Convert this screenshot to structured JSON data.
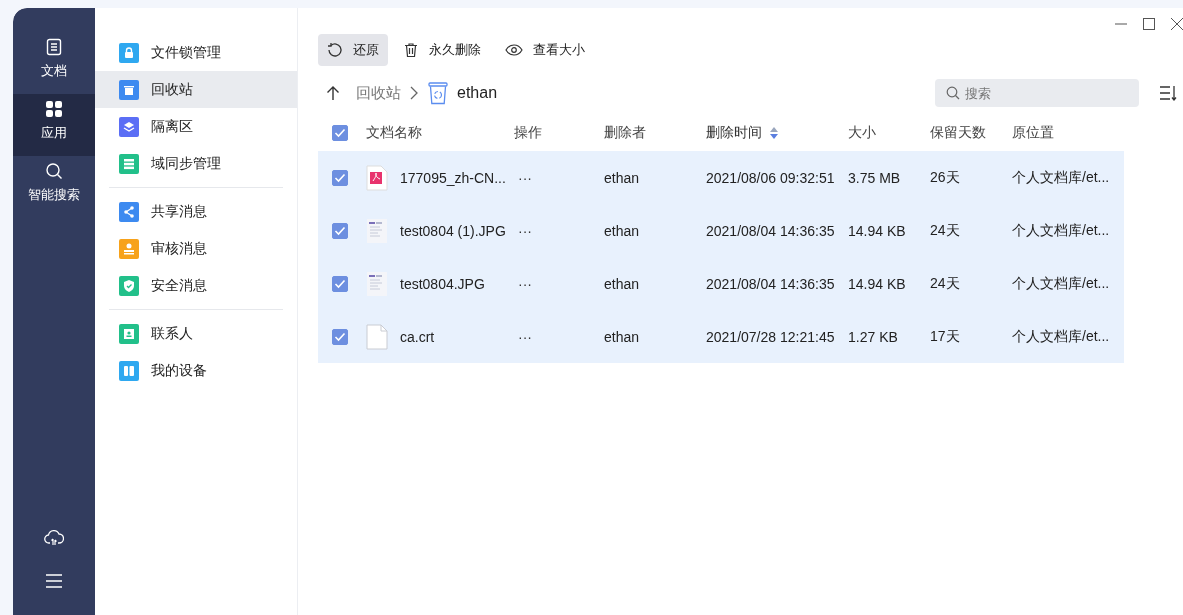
{
  "nav_rail": {
    "items": [
      {
        "label": "文档",
        "selected": false
      },
      {
        "label": "应用",
        "selected": true
      },
      {
        "label": "智能搜索",
        "selected": false
      }
    ]
  },
  "sidebar": {
    "groups": [
      [
        {
          "label": "文件锁管理",
          "color": "#2fa8f0",
          "selected": false
        },
        {
          "label": "回收站",
          "color": "#3d8af0",
          "selected": true
        },
        {
          "label": "隔离区",
          "color": "#5b6ef5",
          "selected": false
        },
        {
          "label": "域同步管理",
          "color": "#22c08a",
          "selected": false
        }
      ],
      [
        {
          "label": "共享消息",
          "color": "#3d8af0",
          "selected": false
        },
        {
          "label": "审核消息",
          "color": "#f7a21b",
          "selected": false
        },
        {
          "label": "安全消息",
          "color": "#22c08a",
          "selected": false
        }
      ],
      [
        {
          "label": "联系人",
          "color": "#22c08a",
          "selected": false
        },
        {
          "label": "我的设备",
          "color": "#2fa8f0",
          "selected": false
        }
      ]
    ]
  },
  "toolbar": [
    {
      "label": "还原",
      "selected": true
    },
    {
      "label": "永久删除",
      "selected": false
    },
    {
      "label": "查看大小",
      "selected": false
    }
  ],
  "breadcrumb": {
    "parent": "回收站",
    "current": "ethan"
  },
  "search": {
    "placeholder": "搜索"
  },
  "table": {
    "all_checked": true,
    "columns": [
      {
        "label": "文档名称",
        "sorted": false
      },
      {
        "label": "操作",
        "sorted": false
      },
      {
        "label": "删除者",
        "sorted": false
      },
      {
        "label": "删除时间",
        "sorted": true
      },
      {
        "label": "大小",
        "sorted": false
      },
      {
        "label": "保留天数",
        "sorted": false
      },
      {
        "label": "原位置",
        "sorted": false
      }
    ],
    "rows": [
      {
        "checked": true,
        "kind": "pdf",
        "name": "177095_zh-CN...",
        "actions": "···",
        "deleter": "ethan",
        "time": "2021/08/06 09:32:51",
        "size": "3.75 MB",
        "days": "26天",
        "location": "个人文档库/et..."
      },
      {
        "checked": true,
        "kind": "image",
        "name": "test0804 (1).JPG",
        "actions": "···",
        "deleter": "ethan",
        "time": "2021/08/04 14:36:35",
        "size": "14.94 KB",
        "days": "24天",
        "location": "个人文档库/et..."
      },
      {
        "checked": true,
        "kind": "image",
        "name": "test0804.JPG",
        "actions": "···",
        "deleter": "ethan",
        "time": "2021/08/04 14:36:35",
        "size": "14.94 KB",
        "days": "24天",
        "location": "个人文档库/et..."
      },
      {
        "checked": true,
        "kind": "file",
        "name": "ca.crt",
        "actions": "···",
        "deleter": "ethan",
        "time": "2021/07/28 12:21:45",
        "size": "1.27 KB",
        "days": "17天",
        "location": "个人文档库/et..."
      }
    ]
  }
}
